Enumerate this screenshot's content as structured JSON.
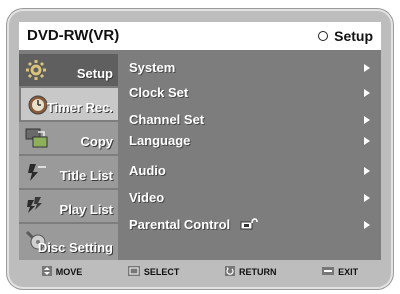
{
  "header": {
    "title": "DVD-RW(VR)",
    "mode_label": "Setup"
  },
  "sidebar": {
    "items": [
      {
        "label": "Setup",
        "icon": "gear-icon"
      },
      {
        "label": "Timer Rec.",
        "icon": "timer-icon"
      },
      {
        "label": "Copy",
        "icon": "copy-icon"
      },
      {
        "label": "Title List",
        "icon": "title-list-icon"
      },
      {
        "label": "Play List",
        "icon": "play-list-icon"
      },
      {
        "label": "Disc Setting",
        "icon": "disc-icon"
      }
    ],
    "active_index": 0
  },
  "menu": {
    "items": [
      {
        "label": "System"
      },
      {
        "label": "Clock Set"
      },
      {
        "label": "Channel Set"
      },
      {
        "label": "Language"
      },
      {
        "label": "Audio"
      },
      {
        "label": "Video"
      },
      {
        "label": "Parental Control"
      }
    ]
  },
  "footer": {
    "move": "MOVE",
    "select": "SELECT",
    "return": "RETURN",
    "exit": "EXIT"
  },
  "colors": {
    "screen_bg": "#7d7d7d",
    "active_tab": "#5f5f5f",
    "tab": "#9a9a9a",
    "text": "#ffffff"
  }
}
